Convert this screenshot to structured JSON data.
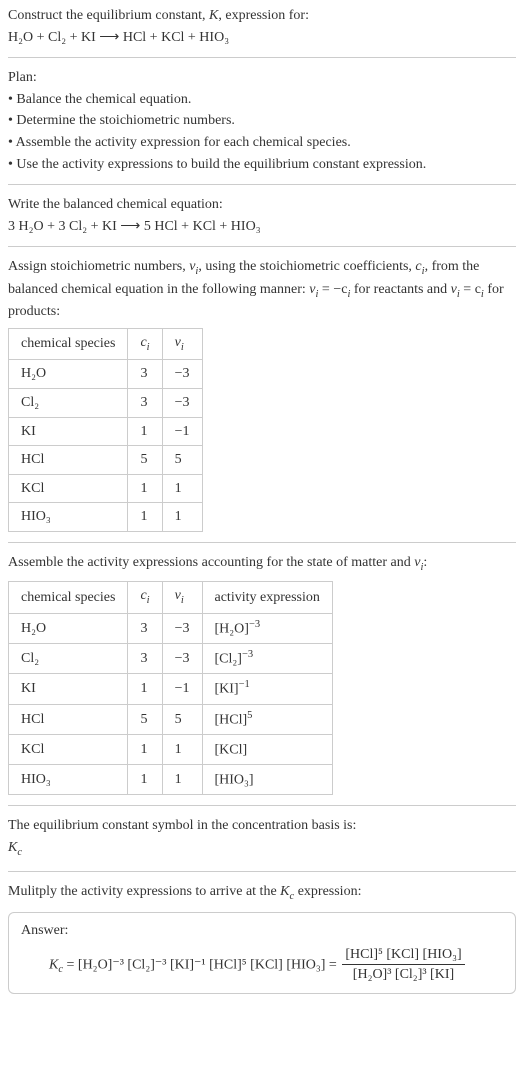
{
  "header": {
    "line1_a": "Construct the equilibrium constant, ",
    "line1_b": ", expression for:",
    "K": "K",
    "unbalanced": "H₂O + Cl₂ + KI ⟶ HCl + KCl + HIO₃"
  },
  "plan": {
    "title": "Plan:",
    "items": [
      "• Balance the chemical equation.",
      "• Determine the stoichiometric numbers.",
      "• Assemble the activity expression for each chemical species.",
      "• Use the activity expressions to build the equilibrium constant expression."
    ]
  },
  "balanced": {
    "label": "Write the balanced chemical equation:",
    "equation": "3 H₂O + 3 Cl₂ + KI ⟶ 5 HCl + KCl + HIO₃"
  },
  "stoich": {
    "text_a": "Assign stoichiometric numbers, ",
    "nu": "ν",
    "i": "i",
    "text_b": ", using the stoichiometric coefficients, ",
    "c": "c",
    "text_c": ", from the balanced chemical equation in the following manner: ",
    "eq1_lhs": "ν",
    "eq1_rhs": " = −c",
    "text_d": " for reactants and ",
    "eq2_lhs": "ν",
    "eq2_rhs": " = c",
    "text_e": " for products:",
    "cols": {
      "species": "chemical species",
      "c": "c",
      "i": "i",
      "nu": "ν"
    },
    "rows": [
      {
        "sp": "H₂O",
        "c": "3",
        "nu": "−3"
      },
      {
        "sp": "Cl₂",
        "c": "3",
        "nu": "−3"
      },
      {
        "sp": "KI",
        "c": "1",
        "nu": "−1"
      },
      {
        "sp": "HCl",
        "c": "5",
        "nu": "5"
      },
      {
        "sp": "KCl",
        "c": "1",
        "nu": "1"
      },
      {
        "sp": "HIO₃",
        "c": "1",
        "nu": "1"
      }
    ]
  },
  "activity": {
    "text_a": "Assemble the activity expressions accounting for the state of matter and ",
    "nu": "ν",
    "i": "i",
    "text_b": ":",
    "cols": {
      "species": "chemical species",
      "c": "c",
      "nu": "ν",
      "ae": "activity expression"
    },
    "rows": [
      {
        "sp": "H₂O",
        "c": "3",
        "nu": "−3",
        "base": "[H₂O]",
        "exp": "−3"
      },
      {
        "sp": "Cl₂",
        "c": "3",
        "nu": "−3",
        "base": "[Cl₂]",
        "exp": "−3"
      },
      {
        "sp": "KI",
        "c": "1",
        "nu": "−1",
        "base": "[KI]",
        "exp": "−1"
      },
      {
        "sp": "HCl",
        "c": "5",
        "nu": "5",
        "base": "[HCl]",
        "exp": "5"
      },
      {
        "sp": "KCl",
        "c": "1",
        "nu": "1",
        "base": "[KCl]",
        "exp": ""
      },
      {
        "sp": "HIO₃",
        "c": "1",
        "nu": "1",
        "base": "[HIO₃]",
        "exp": ""
      }
    ]
  },
  "kc_symbol": {
    "text": "The equilibrium constant symbol in the concentration basis is:",
    "K": "K",
    "c": "c"
  },
  "multiply": {
    "text_a": "Mulitply the activity expressions to arrive at the ",
    "K": "K",
    "c": "c",
    "text_b": " expression:"
  },
  "answer": {
    "label": "Answer:",
    "K": "K",
    "c": "c",
    "eq_left": " = [H₂O]⁻³ [Cl₂]⁻³ [KI]⁻¹ [HCl]⁵ [KCl] [HIO₃] = ",
    "num": "[HCl]⁵ [KCl] [HIO₃]",
    "den": "[H₂O]³ [Cl₂]³ [KI]"
  }
}
